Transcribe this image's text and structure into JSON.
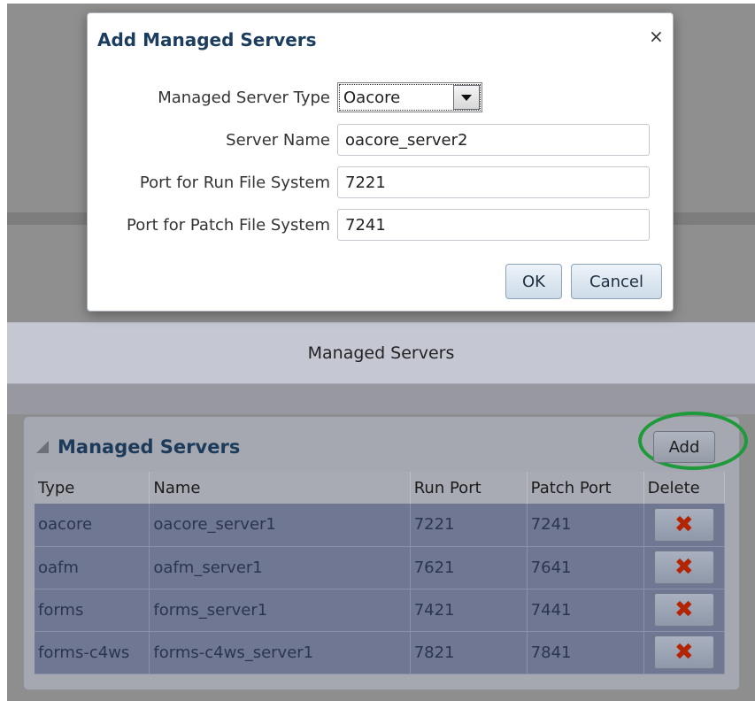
{
  "dialog": {
    "title": "Add Managed Servers",
    "close_glyph": "×",
    "fields": [
      {
        "label": "Managed Server Type",
        "value": "Oacore"
      },
      {
        "label": "Server Name",
        "value": "oacore_server2"
      },
      {
        "label": "Port for Run File System",
        "value": "7221"
      },
      {
        "label": "Port for Patch File System",
        "value": "7241"
      }
    ],
    "ok_label": "OK",
    "cancel_label": "Cancel"
  },
  "section_header": "Managed Servers",
  "panel": {
    "title": "Managed Servers",
    "add_label": "Add",
    "highlight_color": "#1f9a3a",
    "columns": [
      "Type",
      "Name",
      "Run Port",
      "Patch Port",
      "Delete"
    ],
    "rows": [
      {
        "type": "oacore",
        "name": "oacore_server1",
        "run_port": "7221",
        "patch_port": "7241"
      },
      {
        "type": "oafm",
        "name": "oafm_server1",
        "run_port": "7621",
        "patch_port": "7641"
      },
      {
        "type": "forms",
        "name": "forms_server1",
        "run_port": "7421",
        "patch_port": "7441"
      },
      {
        "type": "forms-c4ws",
        "name": "forms-c4ws_server1",
        "run_port": "7821",
        "patch_port": "7841"
      }
    ],
    "delete_icon": "delete-x-icon"
  }
}
